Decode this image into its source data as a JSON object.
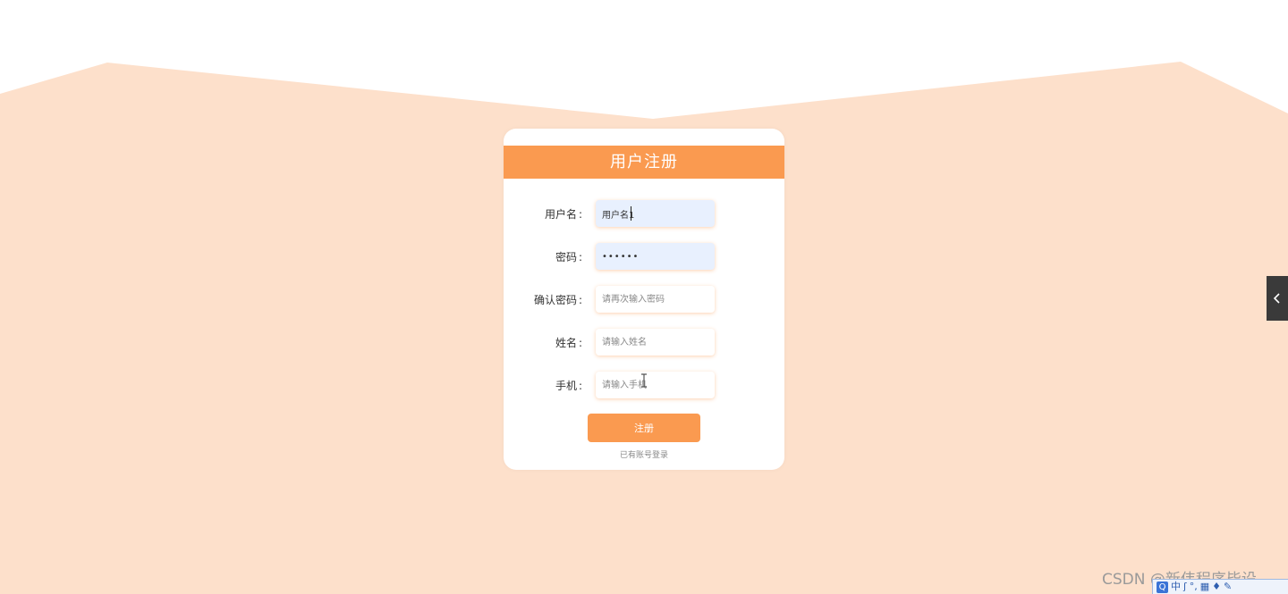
{
  "colors": {
    "accent": "#fa9a50",
    "background_band": "#fde0cb",
    "card": "#ffffff",
    "autofill": "#e8f0fe"
  },
  "form": {
    "title": "用户注册",
    "fields": [
      {
        "label": "用户名",
        "colon": ":",
        "value": "用户名1",
        "placeholder": ""
      },
      {
        "label": "密码",
        "colon": ":",
        "value": "••••••",
        "placeholder": ""
      },
      {
        "label": "确认密码",
        "colon": ":",
        "value": "",
        "placeholder": "请再次输入密码"
      },
      {
        "label": "姓名",
        "colon": ":",
        "value": "",
        "placeholder": "请输入姓名"
      },
      {
        "label": "手机",
        "colon": ":",
        "value": "",
        "placeholder": "请输入手机"
      }
    ],
    "submit_label": "注册",
    "login_link": "已有账号登录"
  },
  "side_toggle": {
    "icon": "chevron-left-icon"
  },
  "watermark": "CSDN @新伟程序毕设",
  "ime": {
    "items": [
      "中",
      "ʃ",
      "°,",
      "▦",
      "♦",
      "✎"
    ]
  }
}
